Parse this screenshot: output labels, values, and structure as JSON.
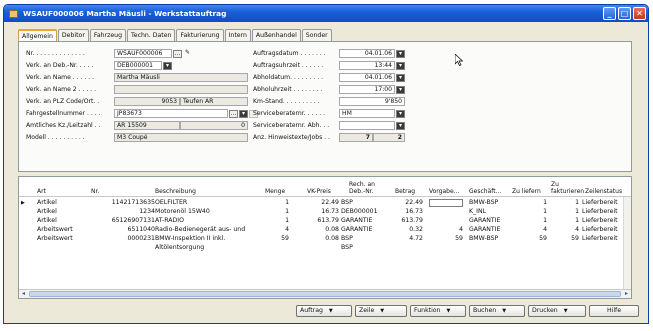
{
  "window": {
    "title": "WSAUF000006 Martha Mäusli - Werkstattauftrag",
    "controls": {
      "minimize": "_",
      "maximize": "□",
      "close": "✕"
    }
  },
  "tabs": [
    "Allgemein",
    "Debitor",
    "Fahrzeug",
    "Techn. Daten",
    "Fakturierung",
    "Intern",
    "Außenhandel",
    "Sonder"
  ],
  "left_fields": {
    "nr": {
      "label": "Nr. . . . . . . . . . . . . .",
      "value": "WSAUF000006"
    },
    "verk_an_deb": {
      "label": "Verk. an Deb.-Nr. . . . .",
      "value": "DEB000001"
    },
    "verk_an_name": {
      "label": "Verk. an Name . . . . . .",
      "value": "Martha Mäusli"
    },
    "verk_an_name2": {
      "label": "Verk. an Name 2 . . . . .",
      "value": ""
    },
    "verk_an_plz": {
      "label": "Verk. an PLZ Code/Ort. .",
      "value_code": "9053",
      "value_city": "Teufen AR"
    },
    "fahrgestell": {
      "label": "Fahrgestellnummer . . . .",
      "value": "JP83673"
    },
    "kz": {
      "label": "Amtliches Kz./Leitzahl . .",
      "value": "AR 15509",
      "value2": "0"
    },
    "modell": {
      "label": "Modell . . . . . . . . . .",
      "value": "M3 Coupé"
    }
  },
  "right_fields": {
    "auftragsdatum": {
      "label": "Auftragsdatum . . . . . . .",
      "value": "04.01.06"
    },
    "auftragsuhrzeit": {
      "label": "Auftragsuhrzeit . . . . . .",
      "value": "13:44"
    },
    "abholdatum": {
      "label": "Abholdatum. . . . . . . . .",
      "value": "04.01.06"
    },
    "abholuhrzeit": {
      "label": "Abholuhrzeit . . . . . . . .",
      "value": "17:00"
    },
    "km_stand": {
      "label": "Km-Stand. . . . . . . . . .",
      "value": "9'850"
    },
    "serviceberater": {
      "label": "Serviceberaternr. . . . . .",
      "value": "HM"
    },
    "serviceberater_abh": {
      "label": "Serviceberaternr. Abh. . .",
      "value": ""
    },
    "hinweistexte": {
      "label": "Anz. Hinweistexte/Jobs . .",
      "value1": "7",
      "value2": "2"
    }
  },
  "grid": {
    "headers": [
      "Art",
      "Nr.",
      "Beschreibung",
      "Menge",
      "VK-Preis",
      "Rech. an\nDeb.-Nr.",
      "Betrag",
      "Vorgabe...",
      "Geschäft...",
      "Zu liefern",
      "Zu\nfakturieren",
      "Zeilenstatus"
    ],
    "rows": [
      {
        "art": "Artikel",
        "nr": "11421713635",
        "beschreibung": "OELFILTER",
        "menge": "1",
        "vk": "22.49",
        "rech": "BSP",
        "betrag": "22.49",
        "vorgabe": "",
        "geschaeft": "BMW-BSP",
        "zuliefern": "1",
        "zufakt": "1",
        "status": "Lieferbereit"
      },
      {
        "art": "Artikel",
        "nr": "1234",
        "beschreibung": "Motorenöl 15W40",
        "menge": "1",
        "vk": "16.73",
        "rech": "DEB000001",
        "betrag": "16.73",
        "vorgabe": "",
        "geschaeft": "K_INL",
        "zuliefern": "1",
        "zufakt": "1",
        "status": "Lieferbereit"
      },
      {
        "art": "Artikel",
        "nr": "65126907131",
        "beschreibung": "AT-RADIO",
        "menge": "1",
        "vk": "613.79",
        "rech": "GARANTIE",
        "betrag": "613.79",
        "vorgabe": "",
        "geschaeft": "GARANTIE",
        "zuliefern": "1",
        "zufakt": "1",
        "status": "Lieferbereit"
      },
      {
        "art": "Arbeitswert",
        "nr": "6511040",
        "beschreibung": "Radio-Bedienegerät aus- und",
        "menge": "4",
        "vk": "0.08",
        "rech": "GARANTIE",
        "betrag": "0.32",
        "vorgabe": "4",
        "geschaeft": "GARANTIE",
        "zuliefern": "4",
        "zufakt": "4",
        "status": "Lieferbereit"
      },
      {
        "art": "Arbeitswert",
        "nr": "0000231",
        "beschreibung": "BMW-Inspektion II inkl.",
        "menge": "59",
        "vk": "0.08",
        "rech": "BSP",
        "betrag": "4.72",
        "vorgabe": "59",
        "geschaeft": "BMW-BSP",
        "zuliefern": "59",
        "zufakt": "59",
        "status": "Lieferbereit"
      },
      {
        "art": "",
        "nr": "",
        "beschreibung": "Altölentsorgung",
        "menge": "",
        "vk": "",
        "rech": "BSP",
        "betrag": "",
        "vorgabe": "",
        "geschaeft": "",
        "zuliefern": "",
        "zufakt": "",
        "status": ""
      }
    ]
  },
  "buttons": [
    {
      "label": "Auftrag",
      "dropdown": true
    },
    {
      "label": "Zeile",
      "dropdown": true
    },
    {
      "label": "Funktion",
      "dropdown": true
    },
    {
      "label": "Buchen",
      "dropdown": true
    },
    {
      "label": "Drucken",
      "dropdown": true
    },
    {
      "label": "Hilfe",
      "dropdown": false
    }
  ],
  "icons": {
    "lookup": "lookup-icon",
    "edit": "pencil-icon",
    "dropdown": "chevron-down-icon"
  },
  "colors": {
    "titlebar": "#1a5fd8",
    "active_tab_accent": "#e5a43e",
    "panel": "#fbfbf9",
    "chrome": "#ece9d8"
  }
}
